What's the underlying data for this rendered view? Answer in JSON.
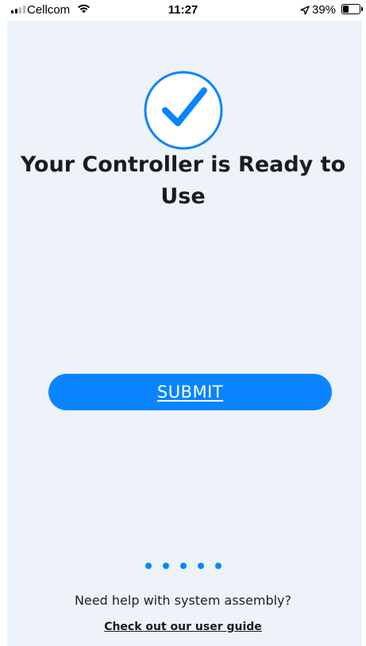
{
  "status_bar": {
    "carrier": "Cellcom",
    "time": "11:27",
    "battery_percent": "39%",
    "battery_level": 0.39,
    "signal_bars_filled": 2,
    "signal_bars_total": 4,
    "icons": [
      "signal-icon",
      "wifi-icon",
      "location-arrow-icon",
      "battery-icon"
    ]
  },
  "main": {
    "status_icon": "checkmark-circle-icon",
    "title": "Your Controller is Ready to Use",
    "submit_label": "SUBMIT",
    "page_dots_count": 5,
    "help_text": "Need help with system assembly?",
    "guide_link": "Check out our user guide"
  },
  "colors": {
    "accent": "#0a84ff",
    "panel_background": "#eef3fa",
    "text": "#1c1c1c"
  }
}
